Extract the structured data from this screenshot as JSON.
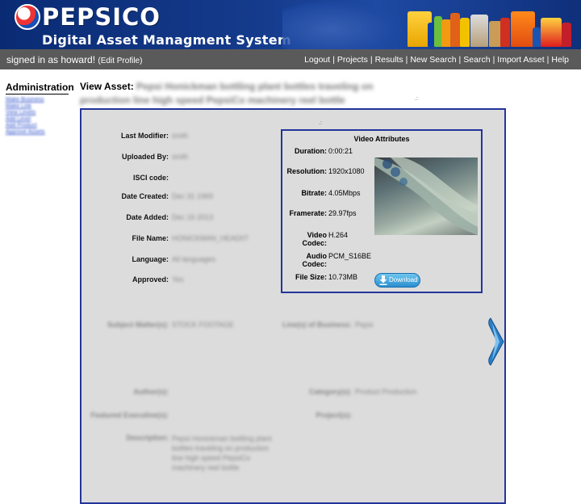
{
  "header": {
    "brand": "PEPSICO",
    "subtitle": "Digital Asset Managment System"
  },
  "navbar": {
    "signed_in_text": "signed in as howard!",
    "edit_profile": "(Edit Profile)",
    "links": [
      "Logout",
      "Projects",
      "Results",
      "New Search",
      "Search",
      "Import Asset",
      "Help"
    ]
  },
  "sidebar": {
    "title": "Administration",
    "links": [
      "Make Business",
      "Make Link",
      "View Levels",
      "Add Level",
      "Add Product",
      "Approve Assets"
    ]
  },
  "asset": {
    "view_label": "View Asset:",
    "title_line1": "Pepsi Honickman bottling plant bottles traveling on",
    "title_line2": "production line high speed PepsiCo machinery reel bottle",
    "fields": [
      {
        "label": "Last Modifier:",
        "value": "sroth"
      },
      {
        "label": "Uploaded By:",
        "value": "sroth"
      },
      {
        "label": "ISCI code:",
        "value": ""
      },
      {
        "label": "Date Created:",
        "value": "Dec 31 1969"
      },
      {
        "label": "Date Added:",
        "value": "Dec 16 2013"
      },
      {
        "label": "File Name:",
        "value": "HONICKMAN_HEAD07"
      },
      {
        "label": "Language:",
        "value": "All languages"
      },
      {
        "label": "Approved:",
        "value": "Yes"
      }
    ],
    "video": {
      "title": "Video Attributes",
      "attributes": [
        {
          "label": "Duration:",
          "value": "0:00:21"
        },
        {
          "label": "Resolution:",
          "value": "1920x1080"
        },
        {
          "label": "Bitrate:",
          "value": "4.05Mbps"
        },
        {
          "label": "Framerate:",
          "value": "29.97fps"
        },
        {
          "label": "Video Codec:",
          "value": "H.264"
        },
        {
          "label": "Audio Codec:",
          "value": "PCM_S16BE"
        },
        {
          "label": "File Size:",
          "value": "10.73MB"
        }
      ],
      "download_label": "Download"
    },
    "meta": {
      "subject_matter_label": "Subject Matter(s):",
      "subject_matter_value": "STOCK FOOTAGE",
      "line_of_business_label": "Line(s) of Business:",
      "line_of_business_value": "Pepsi",
      "authors_label": "Author(s):",
      "categories_label": "Category(s):",
      "categories_value": "Product Production",
      "featured_label": "Featured Executive(s):",
      "projects_label": "Project(s):",
      "description_label": "Description:",
      "description_value": "Pepsi Honickman bottling plant bottles traveling on production line high speed PepsiCo machinery reel bottle"
    }
  },
  "colors": {
    "header_blue": "#0a2b74",
    "nav_gray": "#5a5a5a",
    "panel_border": "#24349a",
    "panel_bg": "#dcdcdc",
    "download_blue": "#2a8fd1"
  }
}
